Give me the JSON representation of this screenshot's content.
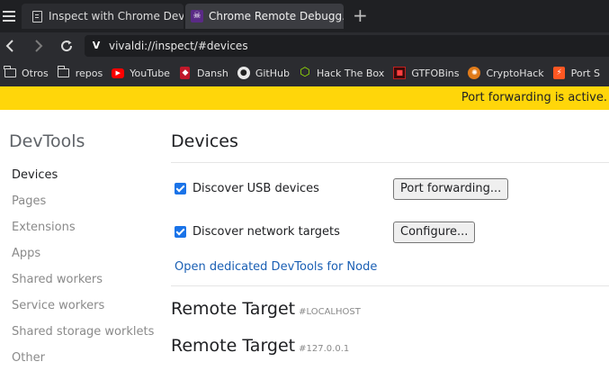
{
  "browser": {
    "tabs": [
      {
        "title": "Inspect with Chrome Develo"
      },
      {
        "title": "Chrome Remote Debugg…"
      }
    ],
    "new_tab_symbol": "+",
    "url": "vivaldi://inspect/#devices",
    "icons": {
      "menu": "menu-icon",
      "back": "back-icon",
      "forward": "forward-icon",
      "reload": "reload-icon",
      "vivaldi": "vivaldi-logo-icon"
    }
  },
  "bookmarks": [
    {
      "label": "Otros",
      "icon": "folder-icon"
    },
    {
      "label": "repos",
      "icon": "folder-icon"
    },
    {
      "label": "YouTube",
      "icon": "youtube-icon"
    },
    {
      "label": "Dansh",
      "icon": "dansh-icon"
    },
    {
      "label": "GitHub",
      "icon": "github-icon"
    },
    {
      "label": "Hack The Box",
      "icon": "hackthebox-icon"
    },
    {
      "label": "GTFOBins",
      "icon": "gtfobins-icon"
    },
    {
      "label": "CryptoHack",
      "icon": "cryptohack-icon"
    },
    {
      "label": "Port S",
      "icon": "portswigger-icon"
    }
  ],
  "infobar": {
    "message": "Port forwarding is active.",
    "color": "#ffd60a"
  },
  "sidebar": {
    "title": "DevTools",
    "items": [
      {
        "label": "Devices",
        "active": true
      },
      {
        "label": "Pages",
        "active": false
      },
      {
        "label": "Extensions",
        "active": false
      },
      {
        "label": "Apps",
        "active": false
      },
      {
        "label": "Shared workers",
        "active": false
      },
      {
        "label": "Service workers",
        "active": false
      },
      {
        "label": "Shared storage worklets",
        "active": false
      },
      {
        "label": "Other",
        "active": false
      }
    ]
  },
  "main": {
    "title": "Devices",
    "discover_usb": {
      "label": "Discover USB devices",
      "checked": true,
      "button": "Port forwarding..."
    },
    "discover_network": {
      "label": "Discover network targets",
      "checked": true,
      "button": "Configure..."
    },
    "node_link": "Open dedicated DevTools for Node",
    "remote_targets": [
      {
        "title": "Remote Target",
        "host": "#LOCALHOST"
      },
      {
        "title": "Remote Target",
        "host": "#127.0.0.1"
      }
    ]
  },
  "colors": {
    "accent": "#1a73e8",
    "link": "#1a5fb4",
    "chrome_dark": "#2b2c30"
  }
}
